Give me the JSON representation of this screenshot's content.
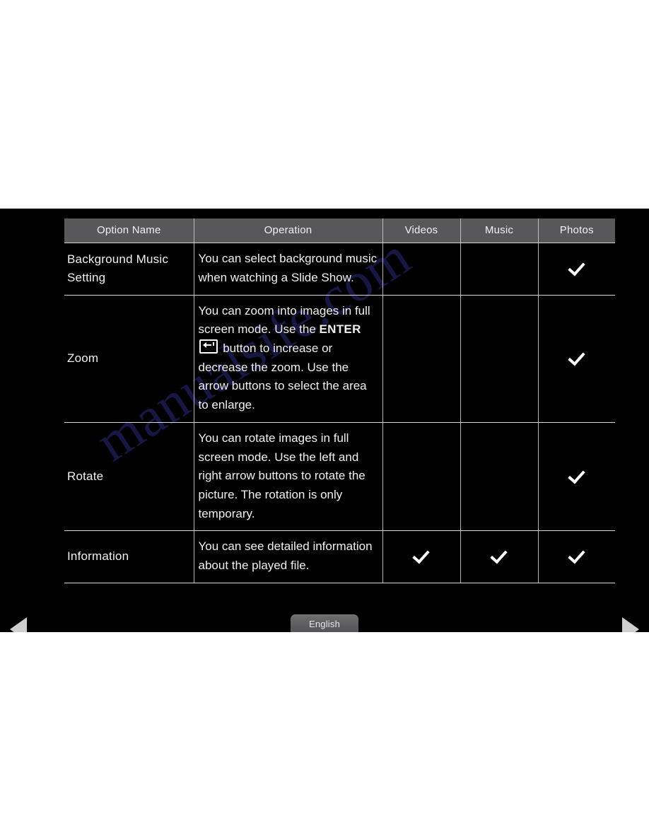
{
  "screen": {
    "watermark_text": "manualsife.com",
    "language_button_label": "English",
    "nav": {
      "prev_label": "Previous page",
      "next_label": "Next page"
    }
  },
  "table": {
    "headers": [
      "Option Name",
      "Operation",
      "Videos",
      "Music",
      "Photos"
    ],
    "rows": [
      {
        "name": "Background  Music Setting",
        "operation_before": "You can select background music when watching a Slide Show.",
        "operation_after": "",
        "has_enter_icon": false,
        "videos": "",
        "music": "",
        "photos": "✓"
      },
      {
        "name": "Zoom",
        "operation_before": "You can zoom into images in full screen mode. Use the ",
        "enter_word": "ENTER",
        "operation_after": " button to increase or decrease the zoom. Use the arrow buttons to select the area to enlarge.",
        "has_enter_icon": true,
        "videos": "",
        "music": "",
        "photos": "✓"
      },
      {
        "name": "Rotate",
        "operation_before": "You can rotate images in full screen mode. Use the left and right arrow buttons to rotate the picture. The rotation is only temporary.",
        "operation_after": "",
        "has_enter_icon": false,
        "videos": "",
        "music": "",
        "photos": "✓"
      },
      {
        "name": "Information",
        "operation_before": "You can see detailed information about the played file.",
        "operation_after": "",
        "has_enter_icon": false,
        "videos": "✓",
        "music": "✓",
        "photos": "✓"
      }
    ]
  },
  "colors": {
    "screen_background": "#000000",
    "header_background": "#58585a",
    "grid_line": "#d8d8d8",
    "text": "#f2f2f2",
    "watermark": "#2a2a80"
  }
}
